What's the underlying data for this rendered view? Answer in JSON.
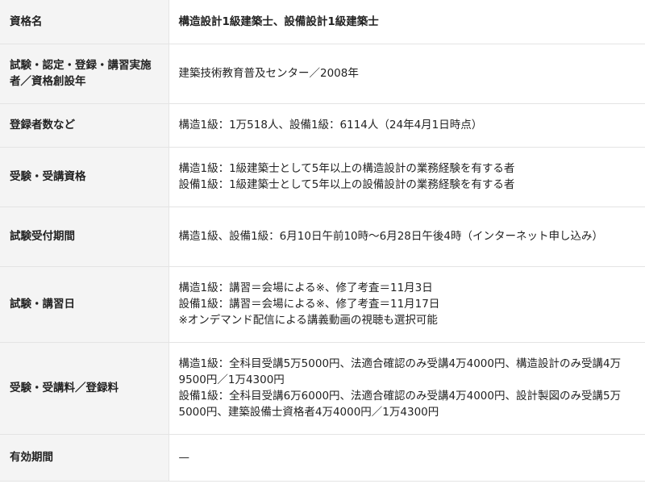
{
  "rows": [
    {
      "label": "資格名",
      "lines": [
        "構造設計1級建築士、設備設計1級建築士"
      ]
    },
    {
      "label": "試験・認定・登録・講習実施者／資格創設年",
      "lines": [
        "建築技術教育普及センター／2008年"
      ]
    },
    {
      "label": "登録者数など",
      "lines": [
        "構造1級：1万518人、設備1級：6114人（24年4月1日時点）"
      ]
    },
    {
      "label": "受験・受講資格",
      "lines": [
        "構造1級：1級建築士として5年以上の構造設計の業務経験を有する者",
        "設備1級：1級建築士として5年以上の設備設計の業務経験を有する者"
      ]
    },
    {
      "label": "試験受付期間",
      "lines": [
        "構造1級、設備1級：6月10日午前10時～6月28日午後4時（インターネット申し込み）"
      ]
    },
    {
      "label": "試験・講習日",
      "lines": [
        "構造1級：講習＝会場による※、修了考査＝11月3日",
        "設備1級：講習＝会場による※、修了考査＝11月17日",
        "※オンデマンド配信による講義動画の視聴も選択可能"
      ]
    },
    {
      "label": "受験・受講料／登録料",
      "lines": [
        "構造1級：全科目受講5万5000円、法適合確認のみ受講4万4000円、構造設計のみ受講4万9500円／1万4300円",
        "設備1級：全科目受講6万6000円、法適合確認のみ受講4万4000円、設計製図のみ受講5万5000円、建築設備士資格者4万4000円／1万4300円"
      ]
    },
    {
      "label": "有効期間",
      "lines": [
        "—"
      ]
    }
  ]
}
